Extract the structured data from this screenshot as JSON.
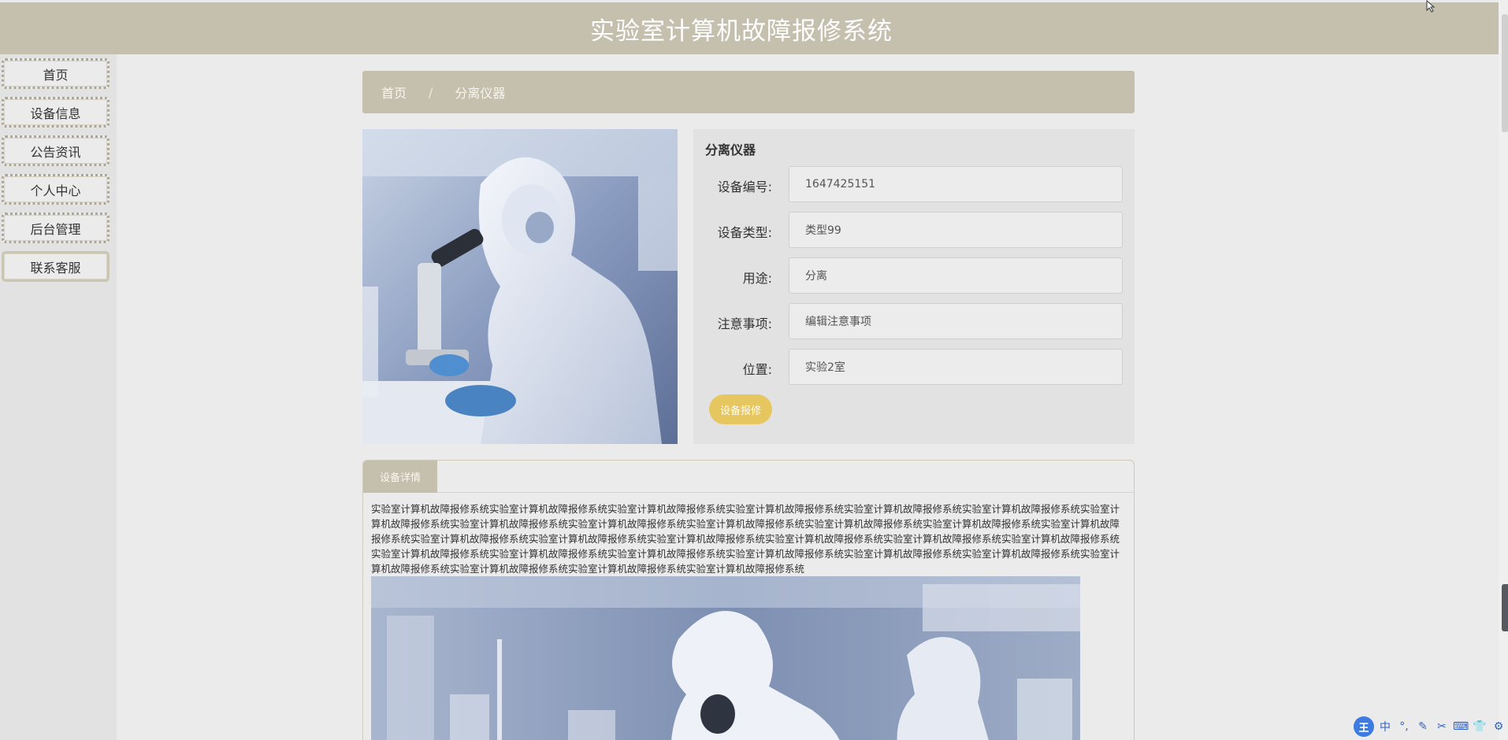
{
  "header": {
    "title": "实验室计算机故障报修系统"
  },
  "sidebar": {
    "items": [
      {
        "label": "首页"
      },
      {
        "label": "设备信息"
      },
      {
        "label": "公告资讯"
      },
      {
        "label": "个人中心"
      },
      {
        "label": "后台管理"
      },
      {
        "label": "联系客服"
      }
    ]
  },
  "breadcrumb": {
    "home": "首页",
    "separator": "/",
    "current": "分离仪器"
  },
  "detail": {
    "title": "分离仪器",
    "fields": [
      {
        "label": "设备编号:",
        "value": "1647425151"
      },
      {
        "label": "设备类型:",
        "value": "类型99"
      },
      {
        "label": "用途:",
        "value": "分离"
      },
      {
        "label": "注意事项:",
        "value": "编辑注意事项"
      },
      {
        "label": "位置:",
        "value": "实验2室"
      }
    ],
    "repair_button": "设备报修"
  },
  "tabs": {
    "details_tab": "设备详情"
  },
  "content": {
    "description": "实验室计算机故障报修系统实验室计算机故障报修系统实验室计算机故障报修系统实验室计算机故障报修系统实验室计算机故障报修系统实验室计算机故障报修系统实验室计算机故障报修系统实验室计算机故障报修系统实验室计算机故障报修系统实验室计算机故障报修系统实验室计算机故障报修系统实验室计算机故障报修系统实验室计算机故障报修系统实验室计算机故障报修系统实验室计算机故障报修系统实验室计算机故障报修系统实验室计算机故障报修系统实验室计算机故障报修系统实验室计算机故障报修系统实验室计算机故障报修系统实验室计算机故障报修系统实验室计算机故障报修系统实验室计算机故障报修系统实验室计算机故障报修系统实验室计算机故障报修系统实验室计算机故障报修系统实验室计算机故障报修系统实验室计算机故障报修系统实验室计算机故障报修系统"
  },
  "ime": {
    "logo": "王",
    "mode": "中",
    "icons": [
      "punctuation-icon",
      "pen-icon",
      "scissors-icon",
      "keyboard-icon",
      "shirt-icon",
      "gear-icon"
    ]
  },
  "colors": {
    "header": "#c5bfae",
    "accent_button": "#e6c65f",
    "background": "#ebebeb"
  }
}
